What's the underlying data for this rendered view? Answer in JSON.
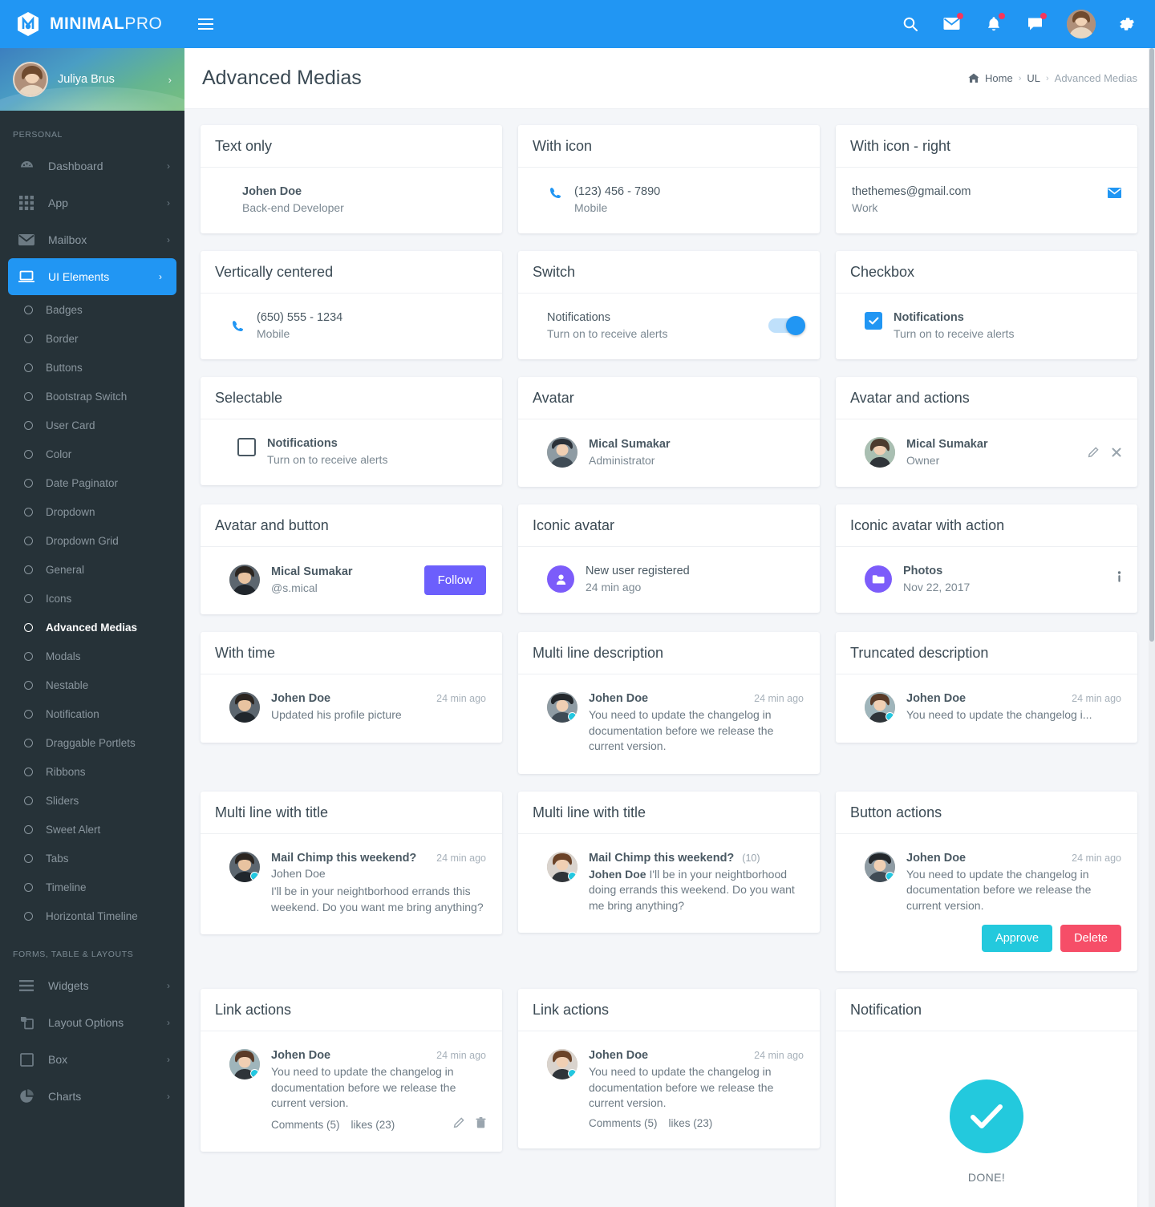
{
  "brand": {
    "bold": "MINIMAL",
    "light": "PRO"
  },
  "topbar": {
    "icons": [
      {
        "name": "search-icon",
        "badge": false
      },
      {
        "name": "mail-icon",
        "badge": true
      },
      {
        "name": "bell-icon",
        "badge": true
      },
      {
        "name": "chat-icon",
        "badge": true
      }
    ],
    "settings_label": "Settings"
  },
  "sidebar": {
    "user": {
      "name": "Juliya Brus",
      "caret": "›"
    },
    "section_personal": "PERSONAL",
    "section_forms": "FORMS, TABLE & LAYOUTS",
    "items": [
      {
        "label": "Dashboard",
        "icon": "dashboard-icon",
        "caret": "›"
      },
      {
        "label": "App",
        "icon": "apps-grid-icon",
        "caret": "›"
      },
      {
        "label": "Mailbox",
        "icon": "envelope-icon",
        "caret": "›"
      },
      {
        "label": "UI Elements",
        "icon": "monitor-icon",
        "caret": "›",
        "active": true
      }
    ],
    "sub_items": [
      {
        "label": "Badges"
      },
      {
        "label": "Border"
      },
      {
        "label": "Buttons"
      },
      {
        "label": "Bootstrap Switch"
      },
      {
        "label": "User Card"
      },
      {
        "label": "Color"
      },
      {
        "label": "Date Paginator"
      },
      {
        "label": "Dropdown"
      },
      {
        "label": "Dropdown Grid"
      },
      {
        "label": "General"
      },
      {
        "label": "Icons"
      },
      {
        "label": "Advanced Medias",
        "active": true
      },
      {
        "label": "Modals"
      },
      {
        "label": "Nestable"
      },
      {
        "label": "Notification"
      },
      {
        "label": "Draggable Portlets"
      },
      {
        "label": "Ribbons"
      },
      {
        "label": "Sliders"
      },
      {
        "label": "Sweet Alert"
      },
      {
        "label": "Tabs"
      },
      {
        "label": "Timeline"
      },
      {
        "label": "Horizontal Timeline"
      }
    ],
    "forms_items": [
      {
        "label": "Widgets",
        "icon": "list-icon",
        "caret": "›"
      },
      {
        "label": "Layout Options",
        "icon": "layers-icon",
        "caret": "›"
      },
      {
        "label": "Box",
        "icon": "square-icon",
        "caret": "›"
      },
      {
        "label": "Charts",
        "icon": "pie-chart-icon",
        "caret": "›"
      }
    ]
  },
  "header": {
    "title": "Advanced Medias",
    "breadcrumb": {
      "home": "Home",
      "mid": "UL",
      "current": "Advanced Medias",
      "sep": "›"
    }
  },
  "cards": {
    "text_only": {
      "title": "Text only",
      "name": "Johen Doe",
      "role": "Back-end Developer"
    },
    "with_icon": {
      "title": "With icon",
      "icon": "phone-icon",
      "value": "(123) 456 - 7890",
      "label": "Mobile"
    },
    "with_icon_right": {
      "title": "With icon - right",
      "icon": "envelope-icon",
      "value": "thethemes@gmail.com",
      "label": "Work"
    },
    "vertically_centered": {
      "title": "Vertically centered",
      "icon": "phone-icon",
      "value": "(650) 555 - 1234",
      "label": "Mobile"
    },
    "switch": {
      "title": "Switch",
      "name": "Notifications",
      "desc": "Turn on to receive alerts",
      "state": "on"
    },
    "checkbox": {
      "title": "Checkbox",
      "name": "Notifications",
      "desc": "Turn on to receive alerts",
      "checked": true
    },
    "selectable": {
      "title": "Selectable",
      "name": "Notifications",
      "desc": "Turn on to receive alerts",
      "checked": false
    },
    "avatar": {
      "title": "Avatar",
      "name": "Mical Sumakar",
      "role": "Administrator"
    },
    "avatar_actions": {
      "title": "Avatar and actions",
      "name": "Mical Sumakar",
      "role": "Owner",
      "actions": [
        "pencil-icon",
        "close-icon"
      ]
    },
    "avatar_button": {
      "title": "Avatar and button",
      "name": "Mical Sumakar",
      "handle": "@s.mical",
      "button": "Follow"
    },
    "iconic_avatar": {
      "title": "Iconic avatar",
      "icon": "user-icon",
      "name": "New user registered",
      "time": "24 min ago"
    },
    "iconic_avatar_action": {
      "title": "Iconic avatar with action",
      "icon": "folder-icon",
      "name": "Photos",
      "date": "Nov 22, 2017",
      "action": "info-icon"
    },
    "with_time": {
      "title": "With time",
      "name": "Johen Doe",
      "time": "24 min ago",
      "text": "Updated his profile picture"
    },
    "multi_line": {
      "title": "Multi line description",
      "name": "Johen Doe",
      "time": "24 min ago",
      "text": "You need to update the changelog in documentation before we release the current version."
    },
    "truncated": {
      "title": "Truncated description",
      "name": "Johen Doe",
      "time": "24 min ago",
      "text": "You need to update the changelog i..."
    },
    "multi_title_a": {
      "title": "Multi line with title",
      "subject": "Mail Chimp this weekend?",
      "time": "24 min ago",
      "name": "Johen Doe",
      "text": "I'll be in your neightborhood errands this weekend. Do you want me bring anything?"
    },
    "multi_title_b": {
      "title": "Multi line with title",
      "subject": "Mail Chimp this weekend?",
      "count": "(10)",
      "name": "Johen Doe",
      "text": "I'll be in your neightborhood doing errands this weekend. Do you want me bring anything?"
    },
    "button_actions": {
      "title": "Button actions",
      "name": "Johen Doe",
      "time": "24 min ago",
      "text": "You need to update the changelog in documentation before we release the current version.",
      "approve": "Approve",
      "delete": "Delete"
    },
    "link_actions_a": {
      "title": "Link actions",
      "name": "Johen Doe",
      "time": "24 min ago",
      "text": "You need to update the changelog in documentation before we release the current version.",
      "comments": "Comments (5)",
      "likes": "likes (23)",
      "actions": [
        "pencil-icon",
        "trash-icon"
      ]
    },
    "link_actions_b": {
      "title": "Link actions",
      "name": "Johen Doe",
      "time": "24 min ago",
      "text": "You need to update the changelog in documentation before we release the current version.",
      "comments": "Comments (5)",
      "likes": "likes (23)"
    },
    "notification": {
      "title": "Notification",
      "icon": "check-icon",
      "label": "DONE!"
    }
  },
  "colors": {
    "primary": "#2196f3",
    "purple": "#6c5ffc",
    "teal": "#23c9dd",
    "red": "#f64e68",
    "sidebar": "#263238"
  }
}
